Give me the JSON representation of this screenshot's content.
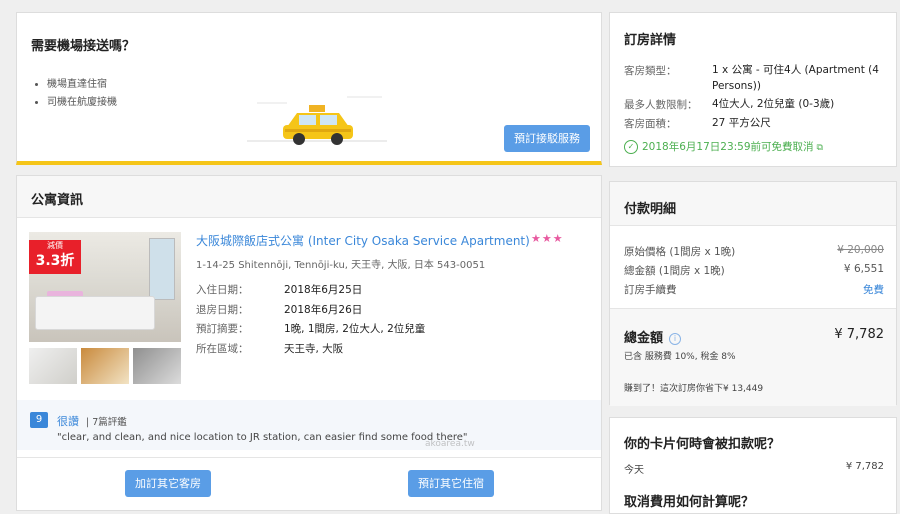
{
  "airport": {
    "title": "需要機場接送嗎？",
    "bullets": [
      "機場直達住宿",
      "司機在航廈接機"
    ],
    "book_button": "預訂接駁服務"
  },
  "apartment": {
    "header": "公寓資訊",
    "badge_small": "減價",
    "badge_big": "3.3折",
    "name": "大阪城際飯店式公寓 (Inter City Osaka Service Apartment)",
    "stars": "★★★",
    "address": "1-14-25 Shitennōji, Tennōji-ku, 天王寺, 大阪, 日本 543-0051",
    "info": [
      {
        "label": "入住日期：",
        "value": "2018年6月25日"
      },
      {
        "label": "退房日期：",
        "value": "2018年6月26日"
      },
      {
        "label": "預訂摘要：",
        "value": "1晚, 1間房, 2位大人, 2位兒童"
      },
      {
        "label": "所在區域：",
        "value": "天王寺, 大阪"
      }
    ],
    "review": {
      "score": "9",
      "title": "很讚",
      "count": "| 7篇評鑑",
      "quote": "\"clear, and clean, and nice location to JR station, can easier find some food there\""
    },
    "add_room_button": "加訂其它客房",
    "book_other_button": "預訂其它住宿"
  },
  "details": {
    "title": "訂房詳情",
    "room_type_label": "客房類型：",
    "room_type_value": "1 x 公寓 - 可住4人 (Apartment (4 Persons))",
    "occupancy_label": "最多人數限制：",
    "occupancy_value": "4位大人, 2位兒童 (0-3歲)",
    "area_label": "客房面積：",
    "area_value": "27 平方公尺",
    "cancel_text": "2018年6月17日23:59前可免費取消"
  },
  "payment": {
    "title": "付款明細",
    "original_label": "原始價格 (1間房 x 1晚)",
    "original_value": "¥ 20,000",
    "subtotal_label": "總金額 (1間房 x 1晚)",
    "subtotal_value": "¥ 6,551",
    "fee_label": "訂房手續費",
    "fee_value": "免費",
    "total_label": "總金額",
    "total_value": "¥ 7,782",
    "tax_note": "已含 服務費 10%, 稅金 8%",
    "savings": "賺到了！這次訂房你省下¥ 13,449"
  },
  "card_question": {
    "title": "你的卡片何時會被扣款呢？",
    "today_label": "今天",
    "today_value": "¥ 7,782",
    "cancel_title": "取消費用如何計算呢？"
  },
  "watermark": "akoarea.tw",
  "colors": {
    "accent": "#5a9de6",
    "link": "#3a87d9",
    "badge": "#e8202a",
    "stars": "#e85aa0",
    "highlight": "#f5c518",
    "success": "#4caf50"
  }
}
